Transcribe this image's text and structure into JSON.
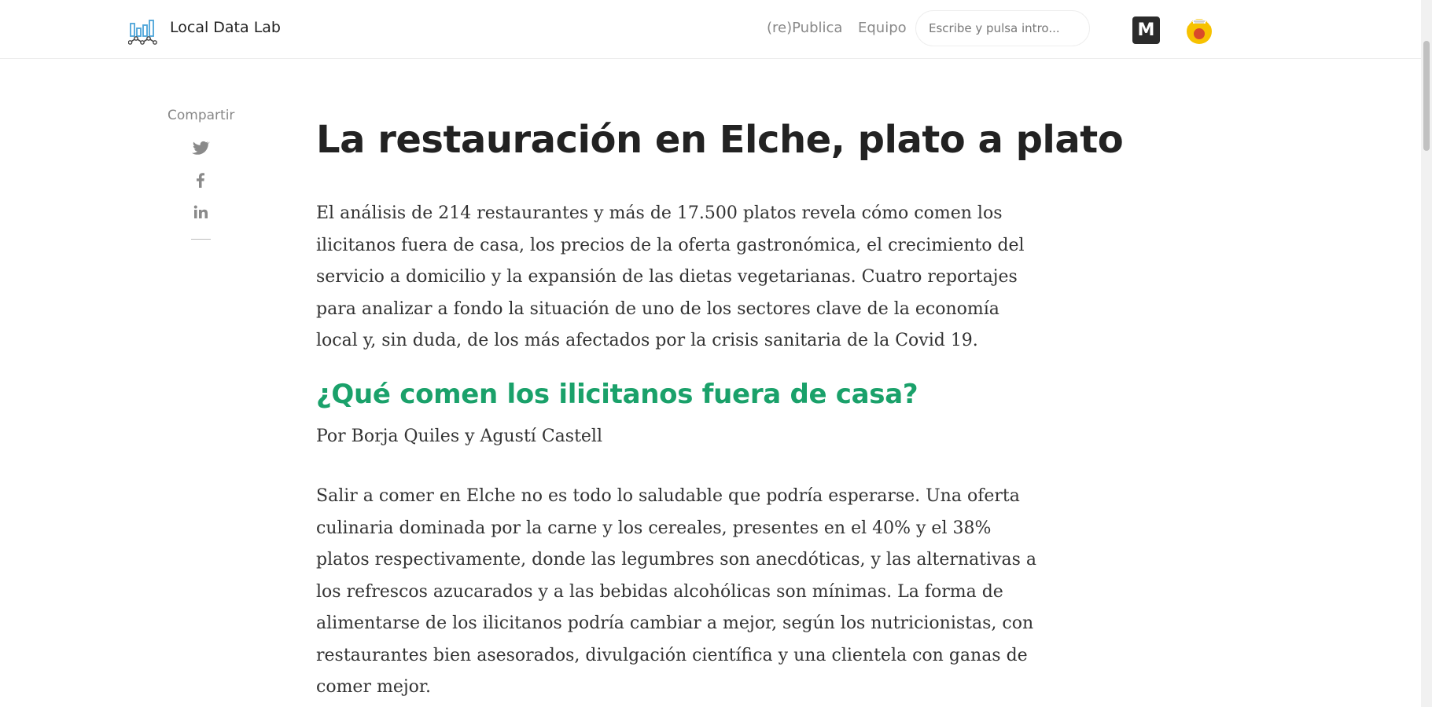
{
  "header": {
    "brand": "Local Data Lab",
    "nav": [
      "(re)Publica",
      "Equipo"
    ],
    "search_placeholder": "Escribe y pulsa intro...",
    "partner_logo_letter": "M",
    "icons": [
      "bar-chart-logo-icon",
      "m-logo-icon",
      "partner-badge-icon"
    ]
  },
  "share": {
    "label": "Compartir",
    "icons": [
      "twitter-icon",
      "facebook-icon",
      "linkedin-icon"
    ]
  },
  "article": {
    "title": "La restauración en Elche, plato a plato",
    "intro": "El análisis de 214 restaurantes y más de 17.500 platos revela cómo comen los ilicitanos fuera de casa, los precios de la oferta gastronómica, el crecimiento del servicio a domicilio y la expansión de las dietas vegetarianas. Cuatro reportajes para analizar a fondo la situación de uno de los sectores clave de la economía local y, sin duda, de los más afectados por la crisis sanitaria de la Covid 19.",
    "section_title": "¿Qué comen los ilicitanos fuera de casa?",
    "byline": "Por Borja Quiles y Agustí Castell",
    "paragraph": "Salir a comer en Elche no es todo lo saludable que podría esperarse. Una oferta culinaria dominada por la carne y los cereales, presentes en el 40% y el 38% platos respectivamente, donde las legumbres son anecdóticas, y las alternativas a los refrescos azucarados y a las bebidas alcohólicas son mínimas. La forma de alimentarse de los ilicitanos podría cambiar a mejor, según los nutricionistas, con restaurantes bien asesorados, divulgación científica y una clientela con ganas de comer mejor."
  },
  "colors": {
    "accent_green": "#1aa16a",
    "title": "#222222",
    "muted": "#888888"
  }
}
